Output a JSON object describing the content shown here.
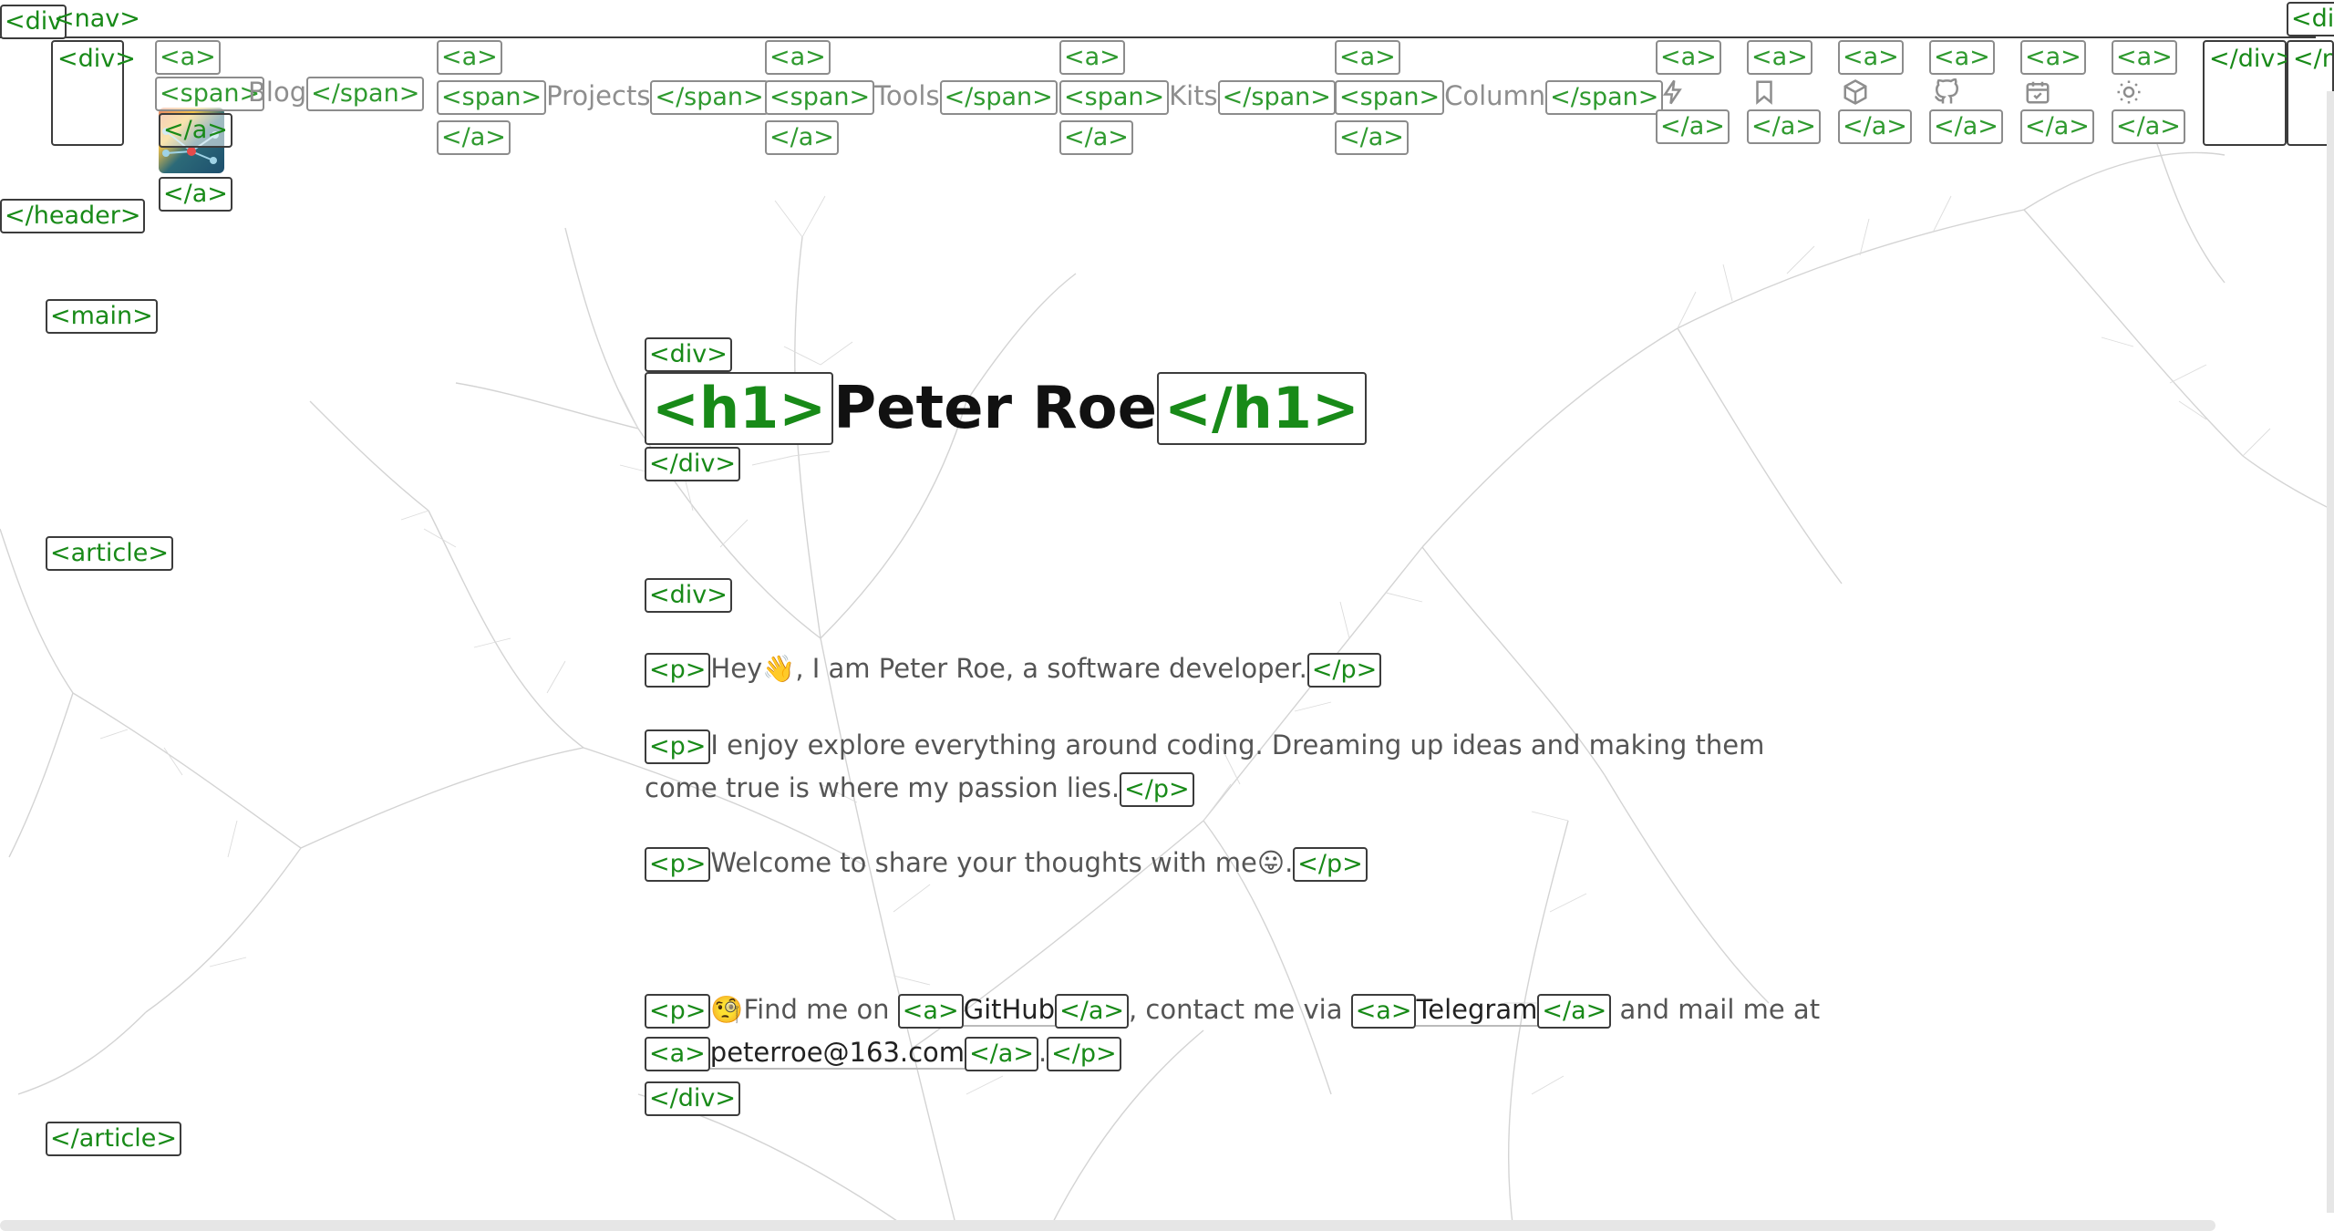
{
  "tags": {
    "div_open": "<div>",
    "div_close": "</div>",
    "div_clip": "<div",
    "div_clip_right": "<di",
    "nav_open": "<nav>",
    "nav_clip": "</n",
    "a_open": "<a>",
    "a_close": "</a>",
    "span_open": "<span>",
    "span_close": "</span>",
    "header_close": "</header>",
    "main_open": "<main>",
    "article_open": "<article>",
    "article_close": "</article>",
    "h1_open": "<h1>",
    "h1_close": "</h1>",
    "p_open": "<p>",
    "p_close": "</p>"
  },
  "nav": {
    "items": [
      {
        "label": "Blog"
      },
      {
        "label": "Projects"
      },
      {
        "label": "Tools"
      },
      {
        "label": "Kits"
      },
      {
        "label": "Column"
      }
    ],
    "icons": [
      "lightning-icon",
      "bookmark-icon",
      "cube-icon",
      "github-icon",
      "calendar-icon",
      "sun-icon"
    ]
  },
  "main": {
    "title": "Peter Roe",
    "p1": {
      "before": "Hey",
      "emoji": "👋",
      "after": ", I am Peter Roe, a software developer."
    },
    "p2": {
      "line1": "I enjoy explore everything around coding. Dreaming up ideas and making them",
      "line2": "come true is where my passion lies."
    },
    "p3": {
      "text": "Welcome to share your thoughts with me",
      "emoji": "😛",
      "end": "."
    },
    "p4": {
      "emoji": "🧐",
      "find": "Find me on ",
      "github": "GitHub",
      "contact": ", contact me via ",
      "telegram": "Telegram",
      "mail": " and mail me at",
      "email": "peterroe@163.com",
      "end": "."
    }
  },
  "colors": {
    "tag_text": "#188a18",
    "tag_border": "#3c3c3c",
    "nav_text": "#8e8e8e",
    "body_text": "#555555",
    "title_text": "#111111"
  }
}
